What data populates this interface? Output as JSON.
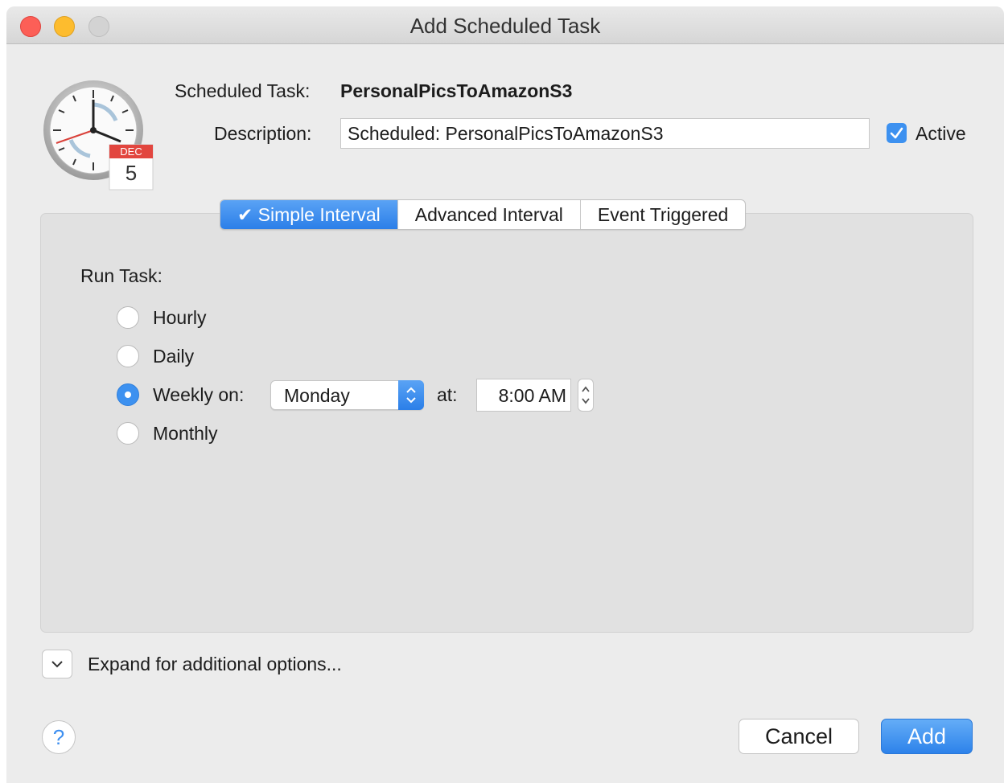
{
  "window": {
    "title": "Add Scheduled Task"
  },
  "icon": {
    "name": "clock-calendar-icon",
    "month": "DEC",
    "day": "5"
  },
  "task": {
    "name_label": "Scheduled Task:",
    "name_value": "PersonalPicsToAmazonS3",
    "description_label": "Description:",
    "description_value": "Scheduled: PersonalPicsToAmazonS3",
    "active_label": "Active",
    "active_checked": true
  },
  "tabs": [
    {
      "label": "✔ Simple Interval",
      "active": true
    },
    {
      "label": "Advanced Interval",
      "active": false
    },
    {
      "label": "Event Triggered",
      "active": false
    }
  ],
  "run_task": {
    "heading": "Run Task:",
    "options": [
      {
        "label": "Hourly",
        "selected": false
      },
      {
        "label": "Daily",
        "selected": false
      },
      {
        "label": "Weekly on:",
        "selected": true
      },
      {
        "label": "Monthly",
        "selected": false
      }
    ],
    "weekday_value": "Monday",
    "at_label": "at:",
    "time_value": "8:00 AM"
  },
  "footer": {
    "expand_label": "Expand for additional options...",
    "help_label": "?",
    "cancel_label": "Cancel",
    "add_label": "Add"
  },
  "colors": {
    "accent": "#3d91f0",
    "close": "#fc5f57",
    "minimize": "#fdbc2e",
    "calendar_red": "#e2463f"
  }
}
